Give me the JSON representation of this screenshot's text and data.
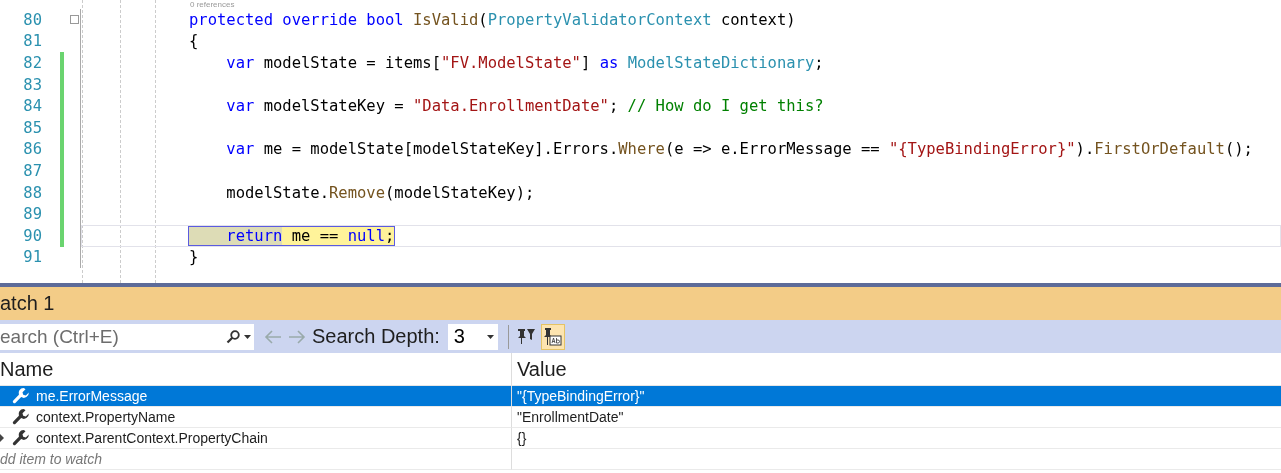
{
  "editor": {
    "codelens": "0 references",
    "lines": [
      {
        "number": "80",
        "fold": true,
        "changed": false,
        "highlighted": false,
        "tokens": [
          {
            "kind": "kw",
            "text": "protected override bool "
          },
          {
            "kind": "method",
            "text": "IsValid"
          },
          {
            "kind": "plain",
            "text": "("
          },
          {
            "kind": "type",
            "text": "PropertyValidatorContext"
          },
          {
            "kind": "plain",
            "text": " context)"
          }
        ]
      },
      {
        "number": "81",
        "fold": false,
        "changed": false,
        "highlighted": false,
        "tokens": [
          {
            "kind": "plain",
            "text": "{"
          }
        ]
      },
      {
        "number": "82",
        "fold": false,
        "changed": true,
        "highlighted": false,
        "tokens": [
          {
            "kind": "kw",
            "text": "    var"
          },
          {
            "kind": "plain",
            "text": " modelState = items["
          },
          {
            "kind": "str",
            "text": "\"FV.ModelState\""
          },
          {
            "kind": "plain",
            "text": "] "
          },
          {
            "kind": "kw",
            "text": "as "
          },
          {
            "kind": "type",
            "text": "ModelStateDictionary"
          },
          {
            "kind": "plain",
            "text": ";"
          }
        ]
      },
      {
        "number": "83",
        "fold": false,
        "changed": true,
        "highlighted": false
      },
      {
        "number": "84",
        "fold": false,
        "changed": true,
        "highlighted": false,
        "tokens": [
          {
            "kind": "kw",
            "text": "    var"
          },
          {
            "kind": "plain",
            "text": " modelStateKey = "
          },
          {
            "kind": "str",
            "text": "\"Data.EnrollmentDate\""
          },
          {
            "kind": "plain",
            "text": "; "
          },
          {
            "kind": "comment",
            "text": "// How do I get this?"
          }
        ]
      },
      {
        "number": "85",
        "fold": false,
        "changed": true,
        "highlighted": false
      },
      {
        "number": "86",
        "fold": false,
        "changed": true,
        "highlighted": false,
        "tokens": [
          {
            "kind": "kw",
            "text": "    var"
          },
          {
            "kind": "plain",
            "text": " me = modelState[modelStateKey].Errors."
          },
          {
            "kind": "method",
            "text": "Where"
          },
          {
            "kind": "plain",
            "text": "(e => e.ErrorMessage == "
          },
          {
            "kind": "str",
            "text": "\"{TypeBindingError}\""
          },
          {
            "kind": "plain",
            "text": ")."
          },
          {
            "kind": "method",
            "text": "FirstOrDefault"
          },
          {
            "kind": "plain",
            "text": "();"
          }
        ]
      },
      {
        "number": "87",
        "fold": false,
        "changed": true,
        "highlighted": false
      },
      {
        "number": "88",
        "fold": false,
        "changed": true,
        "highlighted": false,
        "tokens": [
          {
            "kind": "plain",
            "text": "    modelState."
          },
          {
            "kind": "method",
            "text": "Remove"
          },
          {
            "kind": "plain",
            "text": "(modelStateKey);"
          }
        ]
      },
      {
        "number": "89",
        "fold": false,
        "changed": true,
        "highlighted": false
      },
      {
        "number": "90",
        "fold": false,
        "changed": true,
        "highlighted": true,
        "tokens": [
          {
            "kind": "kw",
            "text": "    return"
          },
          {
            "kind": "plain",
            "text": " me == "
          },
          {
            "kind": "kw",
            "text": "null"
          },
          {
            "kind": "plain",
            "text": ";"
          }
        ]
      },
      {
        "number": "91",
        "fold": false,
        "changed": false,
        "highlighted": false,
        "tokens": [
          {
            "kind": "plain",
            "text": "}"
          }
        ]
      }
    ]
  },
  "watch": {
    "title": "atch 1",
    "search": {
      "placeholder": "earch (Ctrl+E)"
    },
    "search_depth_label": "Search Depth:",
    "search_depth": "3",
    "filter_toggle": {
      "on": true
    },
    "columns": [
      "Name",
      "Value"
    ],
    "rows": [
      {
        "name": "me.ErrorMessage",
        "value": "\"{TypeBindingError}\"",
        "selected": true,
        "expandable": false
      },
      {
        "name": "context.PropertyName",
        "value": "\"EnrollmentDate\"",
        "selected": false,
        "expandable": false
      },
      {
        "name": "context.ParentContext.PropertyChain",
        "value": "{}",
        "selected": false,
        "expandable": true
      }
    ],
    "add_item": "dd item to watch"
  }
}
